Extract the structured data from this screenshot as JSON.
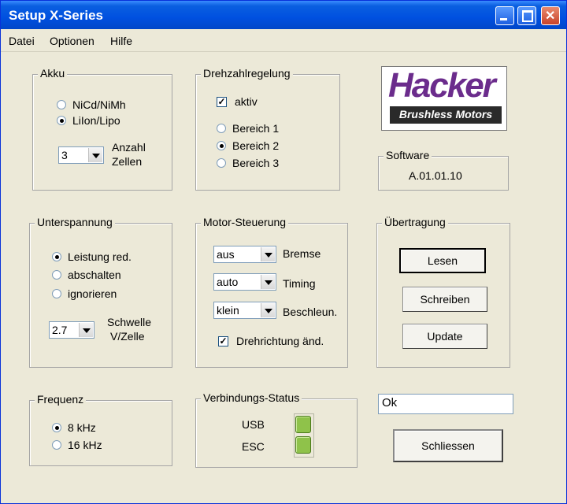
{
  "window": {
    "title": "Setup X-Series"
  },
  "menu": [
    "Datei",
    "Optionen",
    "Hilfe"
  ],
  "logo": {
    "brand": "Hacker",
    "tagline": "Brushless Motors"
  },
  "akku": {
    "title": "Akku",
    "options": [
      "NiCd/NiMh",
      "LiIon/Lipo"
    ],
    "selected": "LiIon/Lipo",
    "cells_value": "3",
    "cells_label_1": "Anzahl",
    "cells_label_2": "Zellen"
  },
  "drehzahl": {
    "title": "Drehzahlregelung",
    "aktiv_label": "aktiv",
    "aktiv_checked": true,
    "options": [
      "Bereich 1",
      "Bereich 2",
      "Bereich 3"
    ],
    "selected": "Bereich 2"
  },
  "software": {
    "title": "Software",
    "version": "A.01.01.10"
  },
  "unterspannung": {
    "title": "Unterspannung",
    "options": [
      "Leistung red.",
      "abschalten",
      "ignorieren"
    ],
    "selected": "Leistung red.",
    "threshold_value": "2.7",
    "threshold_label_1": "Schwelle",
    "threshold_label_2": "V/Zelle"
  },
  "motor": {
    "title": "Motor-Steuerung",
    "bremse": {
      "value": "aus",
      "label": "Bremse"
    },
    "timing": {
      "value": "auto",
      "label": "Timing"
    },
    "beschleun": {
      "value": "klein",
      "label": "Beschleun."
    },
    "drehrichtung_label": "Drehrichtung änd.",
    "drehrichtung_checked": true
  },
  "uebertragung": {
    "title": "Übertragung",
    "lesen": "Lesen",
    "schreiben": "Schreiben",
    "update": "Update"
  },
  "frequenz": {
    "title": "Frequenz",
    "options": [
      "8 kHz",
      "16 kHz"
    ],
    "selected": "8 kHz"
  },
  "status": {
    "title": "Verbindungs-Status",
    "usb_label": "USB",
    "esc_label": "ESC",
    "led_color": "#8fc24a"
  },
  "status_field": {
    "value": "Ok"
  },
  "schliessen": "Schliessen"
}
